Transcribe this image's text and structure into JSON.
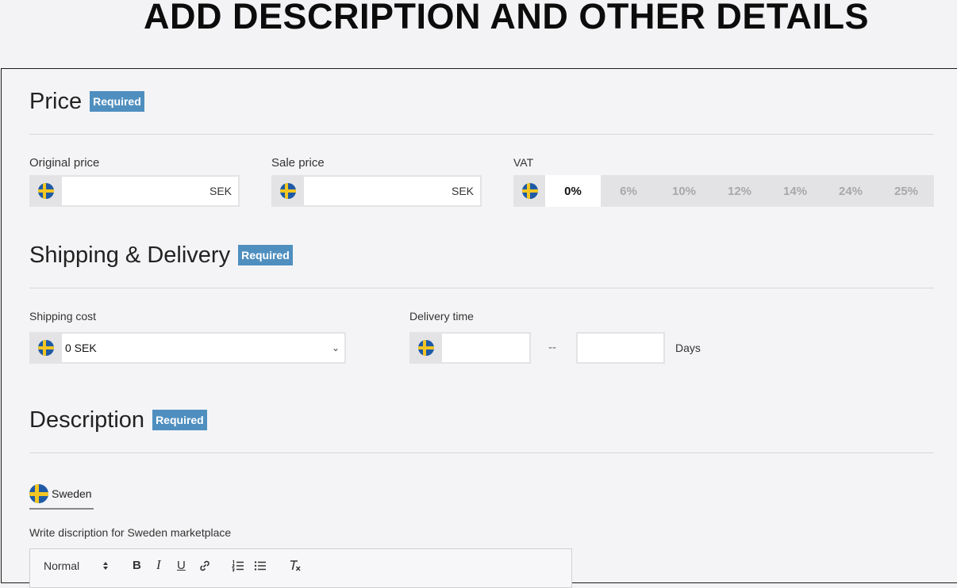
{
  "heading": "ADD DESCRIPTION AND OTHER DETAILS",
  "sections": {
    "price": {
      "title": "Price",
      "badge": "Required"
    },
    "shipping": {
      "title": "Shipping & Delivery",
      "badge": "Required"
    },
    "description": {
      "title": "Description",
      "badge": "Required"
    }
  },
  "price": {
    "original_label": "Original price",
    "original_value": "",
    "original_currency": "SEK",
    "sale_label": "Sale price",
    "sale_value": "",
    "sale_currency": "SEK",
    "vat_label": "VAT",
    "vat_options": [
      "0%",
      "6%",
      "10%",
      "12%",
      "14%",
      "24%",
      "25%"
    ],
    "vat_selected": "0%"
  },
  "shipping": {
    "cost_label": "Shipping cost",
    "cost_value": "0 SEK",
    "delivery_label": "Delivery time",
    "delivery_from": "",
    "delivery_to": "",
    "separator": "--",
    "unit": "Days"
  },
  "description": {
    "tab_label": "Sweden",
    "prompt": "Write discription for Sweden marketplace",
    "toolbar": {
      "style_value": "Normal",
      "bold": "B",
      "italic": "I",
      "underline": "U"
    }
  },
  "colors": {
    "badge": "#4f8fbf",
    "flag_blue": "#1f5aa6",
    "flag_yellow": "#f3c623"
  },
  "icons": [
    "sweden-flag-icon",
    "chevron-down-icon",
    "link-icon",
    "ordered-list-icon",
    "bullet-list-icon",
    "clear-format-icon",
    "sort-arrows-icon"
  ]
}
